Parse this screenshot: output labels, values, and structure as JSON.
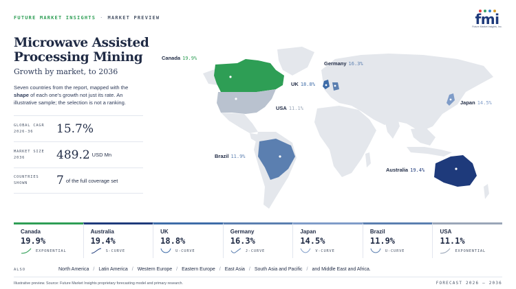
{
  "header": {
    "brand": "FUTURE MARKET INSIGHTS",
    "separator": "·",
    "section": "MARKET PREVIEW"
  },
  "logo": {
    "wordmark": "fmi",
    "tagline": "Future Market Insights, Inc.",
    "dot_colors": [
      "#e53e3e",
      "#38a169",
      "#3182ce",
      "#d69e2e"
    ]
  },
  "title": "Microwave Assisted Processing Mining",
  "subtitle": "Growth by market, to 2036",
  "intro": {
    "part1": "Seven countries from the report, mapped with the ",
    "bold": "shape",
    "part2": " of each one's growth not just its rate. An illustrative sample; the selection is not a ranking."
  },
  "stats": {
    "cagr_label_1": "GLOBAL CAGR",
    "cagr_label_2": "2026-36",
    "cagr_value": "15.7%",
    "size_label_1": "MARKET SIZE",
    "size_label_2": "2036",
    "size_value": "489.2",
    "size_unit": "USD Mn",
    "countries_label_1": "COUNTRIES",
    "countries_label_2": "SHOWN",
    "countries_value": "7",
    "countries_unit": "of the full coverage set"
  },
  "map_labels": [
    {
      "name": "Canada",
      "value": "19.9%",
      "color": "#2e9e55"
    },
    {
      "name": "Germany",
      "value": "16.3%",
      "color": "#5b7fb0"
    },
    {
      "name": "UK",
      "value": "18.8%",
      "color": "#3e6ca8"
    },
    {
      "name": "USA",
      "value": "11.1%",
      "color": "#9aa6b8"
    },
    {
      "name": "Japan",
      "value": "14.5%",
      "color": "#7f9cc8"
    },
    {
      "name": "Brazil",
      "value": "11.9%",
      "color": "#5b7fb0"
    },
    {
      "name": "Australia",
      "value": "19.4%",
      "color": "#1e3a7b"
    }
  ],
  "cards": [
    {
      "name": "Canada",
      "value": "19.9%",
      "shape": "EXPONENTIAL",
      "color": "#2e9e55"
    },
    {
      "name": "Australia",
      "value": "19.4%",
      "shape": "S-CURVE",
      "color": "#1e3a7b"
    },
    {
      "name": "UK",
      "value": "18.8%",
      "shape": "U-CURVE",
      "color": "#3e6ca8"
    },
    {
      "name": "Germany",
      "value": "16.3%",
      "shape": "J-CURVE",
      "color": "#5b7fb0"
    },
    {
      "name": "Japan",
      "value": "14.5%",
      "shape": "V-CURVE",
      "color": "#7f9cc8"
    },
    {
      "name": "Brazil",
      "value": "11.9%",
      "shape": "U-CURVE",
      "color": "#5b7fb0"
    },
    {
      "name": "USA",
      "value": "11.1%",
      "shape": "EXPONENTIAL",
      "color": "#9aa6b8"
    }
  ],
  "also": {
    "label": "ALSO",
    "items": [
      "North America",
      "Latin America",
      "Western Europe",
      "Eastern Europe",
      "East Asia",
      "South Asia and Pacific",
      "and Middle East and Africa."
    ]
  },
  "footer": {
    "note": "Illustrative preview. Source: Future Market Insights proprietary forecasting model and primary research.",
    "forecast": "FORECAST 2026 – 2036"
  },
  "colors": {
    "land": "#e4e7ec",
    "canada": "#2e9e55",
    "usa": "#b9c2cf",
    "brazil": "#5b7fb0",
    "australia": "#1e3a7b",
    "uk": "#3e6ca8",
    "germany": "#5b7fb0",
    "japan": "#7f9cc8",
    "card_border": "#c5cbd6"
  }
}
